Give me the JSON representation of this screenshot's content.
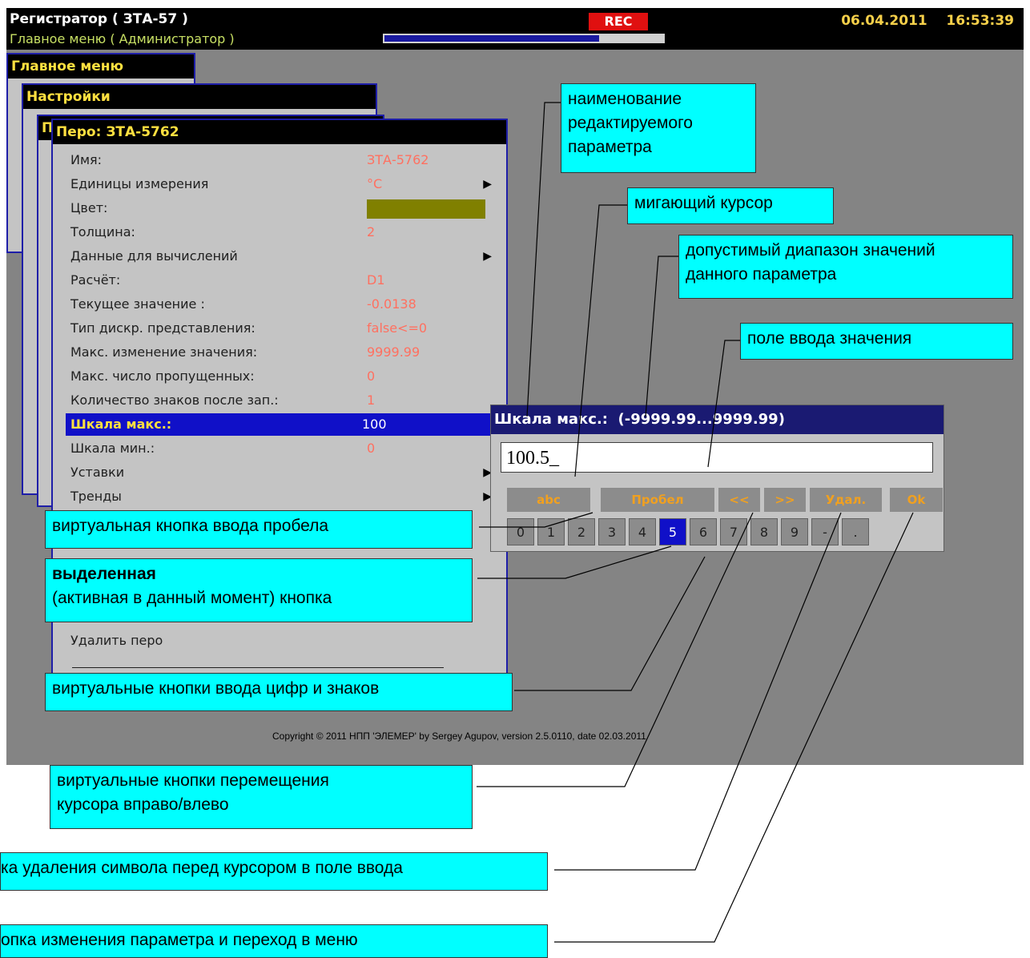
{
  "topbar": {
    "title": "Регистратор ( ЗТА-57 )",
    "subtitle": "Главное меню ( Администратор )",
    "rec": "REC",
    "date": "06.04.2011",
    "time": "16:53:39",
    "progress_fraction": 0.77
  },
  "windows": {
    "main_menu": "Главное меню",
    "settings": "Настройки",
    "pen_title": "Перо: ЗТА-5762",
    "hidden_tab": "П"
  },
  "pen_rows": [
    {
      "label": "Имя:",
      "value": "ЗТА-5762"
    },
    {
      "label": "Единицы измерения",
      "value": "°C",
      "arrow": "▶"
    },
    {
      "label": "Цвет:",
      "value": ""
    },
    {
      "label": "Толщина:",
      "value": "2"
    },
    {
      "label": "Данные для вычислений",
      "value": "",
      "arrow": "▶"
    },
    {
      "label": "Расчёт:",
      "value": "D1"
    },
    {
      "label": "Текущее значение :",
      "value": "-0.0138"
    },
    {
      "label": "Тип дискр. представления:",
      "value": "false<=0"
    },
    {
      "label": "Макс. изменение значения:",
      "value": "9999.99"
    },
    {
      "label": "Макс. число пропущенных:",
      "value": "0"
    },
    {
      "label": "Количество знаков после зап.:",
      "value": "1"
    },
    {
      "label": "Шкала макс.:",
      "value": "100"
    },
    {
      "label": "Шкала мин.:",
      "value": "0"
    },
    {
      "label": "Уставки",
      "value": "",
      "arrow": "▶"
    },
    {
      "label": "Тренды",
      "value": "",
      "arrow": "▶"
    }
  ],
  "delete_pen": "Удалить перо",
  "dialog": {
    "title": "Шкала макс.:",
    "range": "(-9999.99...9999.99)",
    "input_value": "100.5",
    "cursor": "_",
    "buttons": [
      "abc",
      "Пробел",
      "<<",
      ">>",
      "Удал.",
      "Ok"
    ],
    "keys": [
      "0",
      "1",
      "2",
      "3",
      "4",
      "5",
      "6",
      "7",
      "8",
      "9",
      "-",
      "."
    ],
    "active_key": "5"
  },
  "colors": {
    "pen_color": "#808000",
    "selection": "#1010c8",
    "callout": "#00ffff",
    "value_text": "#ff7060"
  },
  "callouts": {
    "param_name": [
      "наименование",
      "редактируемого",
      "параметра"
    ],
    "cursor": "мигающий курсор",
    "range": [
      "допустимый диапазон значений",
      "данного параметра"
    ],
    "input_field": "поле ввода значения",
    "space_btn": "виртуальная кнопка ввода пробела",
    "active_btn_bold": "выделенная",
    "active_btn_rest": "(активная в данный момент) кнопка",
    "digit_btns": "виртуальные кнопки ввода цифр и знаков",
    "move_btns": [
      "виртуальные кнопки перемещения",
      "курсора вправо/влево"
    ],
    "delete_btn": "ка удаления символа перед курсором в поле ввода",
    "ok_btn": "опка изменения параметра и переход в меню"
  },
  "copyright": "Copyright © 2011 НПП 'ЭЛЕМЕР' by Sergey Agupov, version 2.5.0110, date 02.03.2011"
}
